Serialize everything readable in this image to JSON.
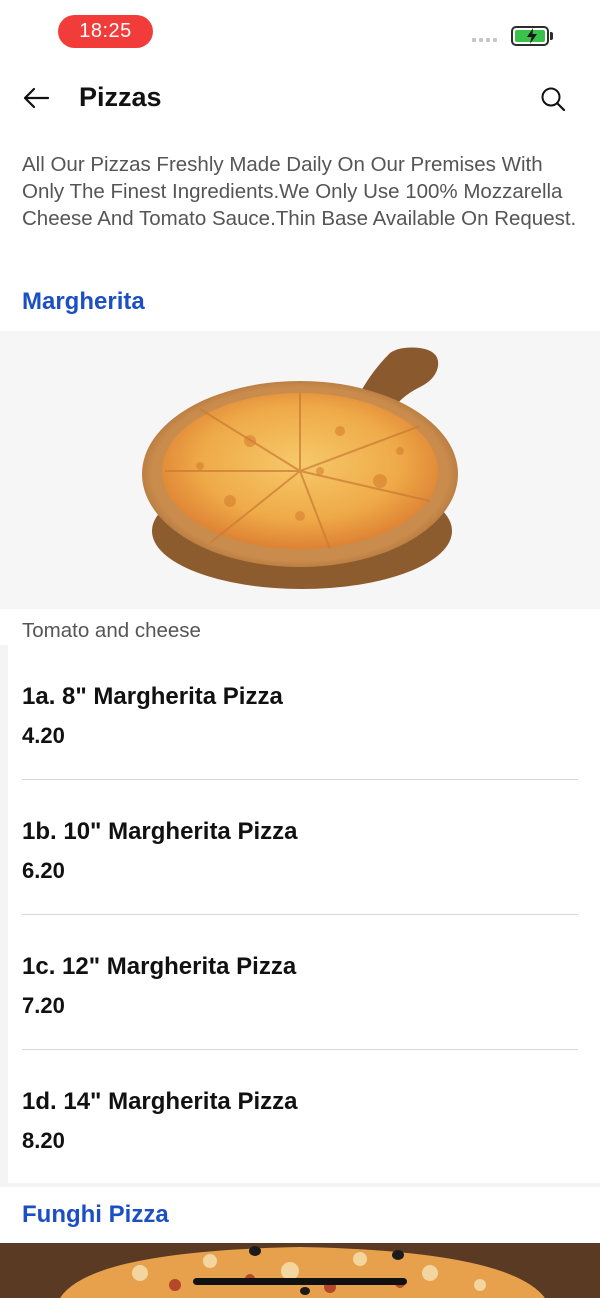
{
  "status_bar": {
    "time": "18:25"
  },
  "header": {
    "title": "Pizzas"
  },
  "intro": "All Our Pizzas Freshly Made Daily On Our Premises With Only The Finest Ingredients.We Only Use 100% Mozzarella Cheese And Tomato Sauce.Thin Base Available On Request.",
  "sections": [
    {
      "title": "Margherita",
      "description": "Tomato and cheese",
      "items": [
        {
          "name": "1a. 8\" Margherita Pizza",
          "price": "4.20"
        },
        {
          "name": "1b. 10\" Margherita Pizza",
          "price": "6.20"
        },
        {
          "name": "1c. 12\" Margherita Pizza",
          "price": "7.20"
        },
        {
          "name": "1d. 14\" Margherita Pizza",
          "price": "8.20"
        }
      ]
    },
    {
      "title": "Funghi Pizza"
    }
  ],
  "colors": {
    "accent": "#1d4fc4",
    "time_pill": "#f23c3a",
    "battery": "#39c24a"
  }
}
